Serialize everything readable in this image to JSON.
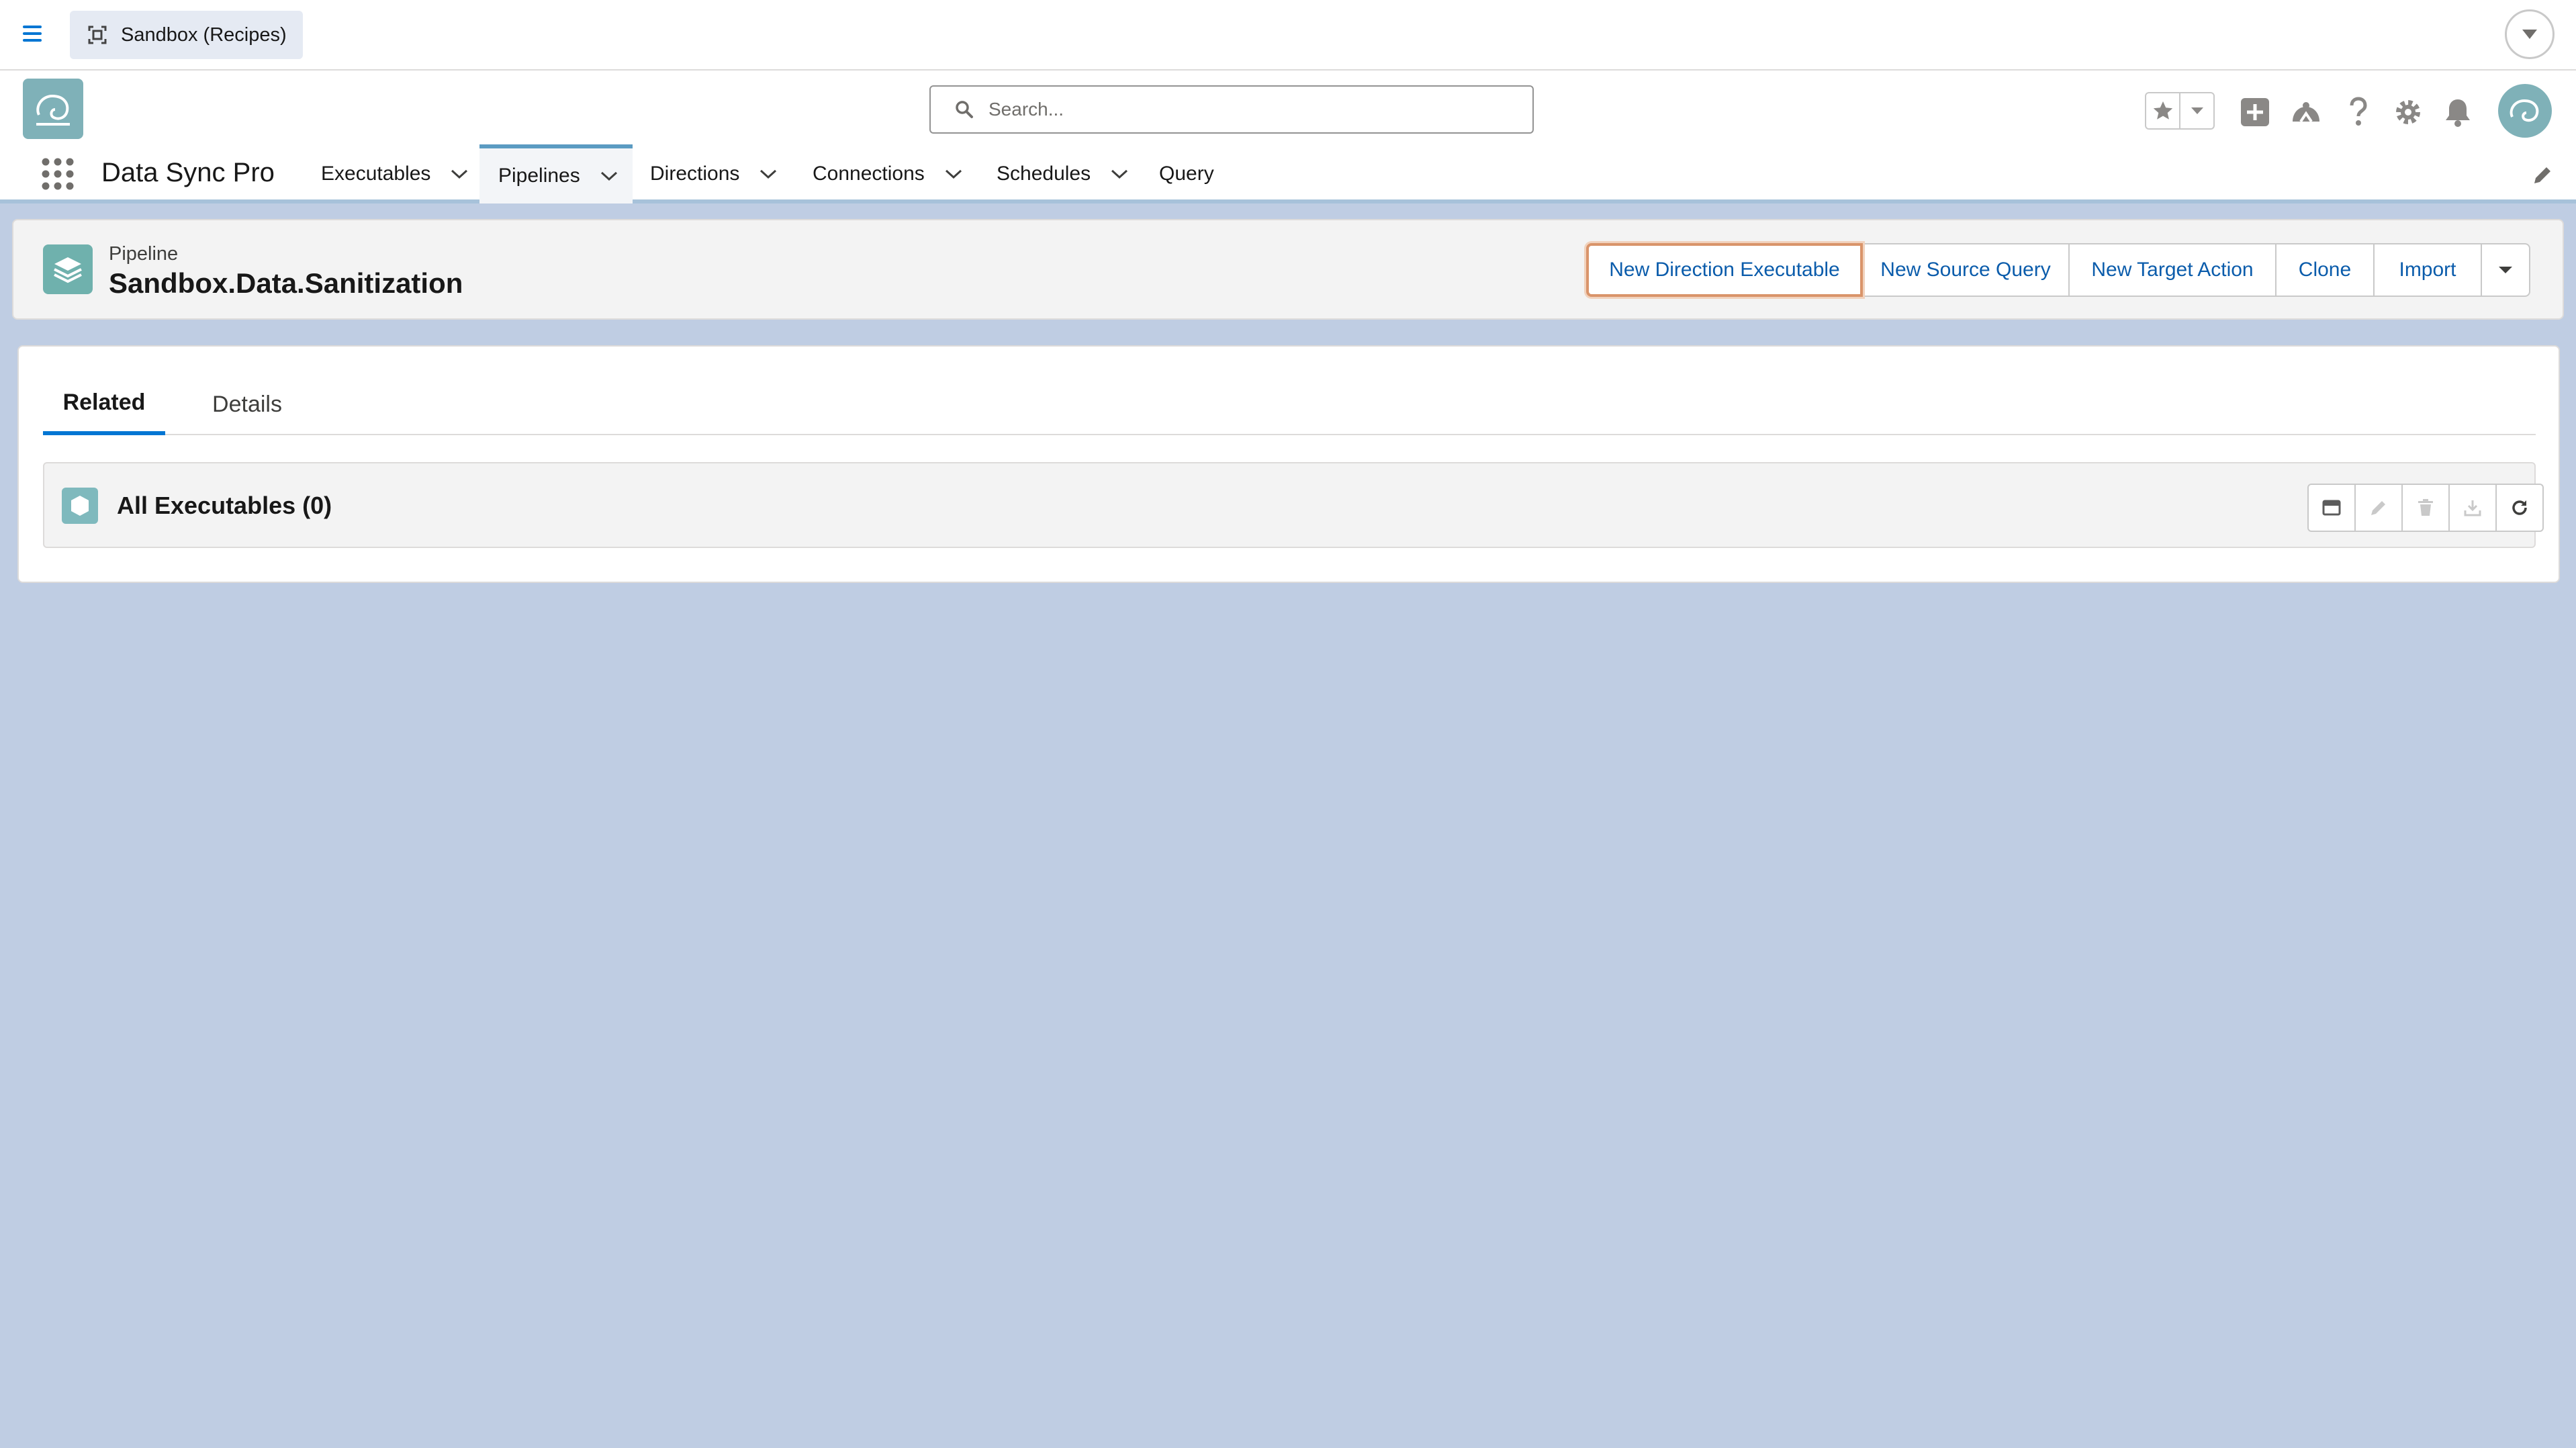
{
  "topbar": {
    "sandbox_label": "Sandbox (Recipes)"
  },
  "header": {
    "search_placeholder": "Search..."
  },
  "nav": {
    "app_name": "Data Sync Pro",
    "items": [
      {
        "label": "Executables",
        "has_menu": true,
        "active": false
      },
      {
        "label": "Pipelines",
        "has_menu": true,
        "active": true
      },
      {
        "label": "Directions",
        "has_menu": true,
        "active": false
      },
      {
        "label": "Connections",
        "has_menu": true,
        "active": false
      },
      {
        "label": "Schedules",
        "has_menu": true,
        "active": false
      },
      {
        "label": "Query",
        "has_menu": false,
        "active": false
      }
    ]
  },
  "record": {
    "type": "Pipeline",
    "title": "Sandbox.Data.Sanitization",
    "actions": [
      {
        "label": "New Direction Executable",
        "focused": true
      },
      {
        "label": "New Source Query",
        "focused": false
      },
      {
        "label": "New Target Action",
        "focused": false
      },
      {
        "label": "Clone",
        "focused": false
      },
      {
        "label": "Import",
        "focused": false
      }
    ]
  },
  "tabs": [
    {
      "label": "Related",
      "active": true
    },
    {
      "label": "Details",
      "active": false
    }
  ],
  "related_list": {
    "title": "All Executables (0)",
    "actions": [
      "table-view-icon",
      "edit-icon",
      "delete-icon",
      "download-icon",
      "refresh-icon"
    ]
  },
  "colors": {
    "brand_blue": "#0176d3",
    "link_blue": "#0b5cab",
    "page_background": "#bfcde3",
    "focus_outline": "#d9946a",
    "record_icon": "#6fb1ad"
  }
}
